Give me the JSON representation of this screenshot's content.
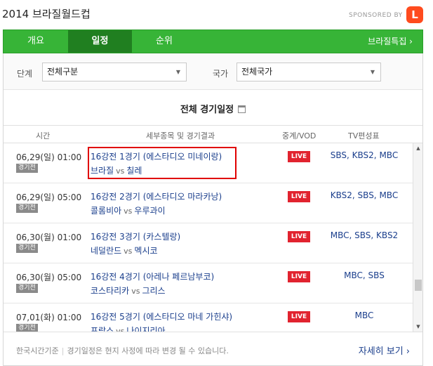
{
  "header": {
    "title": "2014 브라질월드컵",
    "sponsored_by": "SPONSORED BY"
  },
  "tabs": [
    {
      "label": "개요"
    },
    {
      "label": "일정"
    },
    {
      "label": "순위"
    }
  ],
  "special_link": "브라질특집 ›",
  "filters": {
    "stage_label": "단계",
    "stage_value": "전체구분",
    "country_label": "국가",
    "country_value": "전체국가"
  },
  "section_title": "전체 경기일정",
  "columns": {
    "time": "시간",
    "detail": "세부종목 및 경기결과",
    "relay": "중계/VOD",
    "tv": "TV편성표"
  },
  "matches": [
    {
      "time": "06,29(일) 01:00",
      "badge": "경기전",
      "title": "16강전 1경기 (에스타디오 미네이랑)",
      "home": "브라질",
      "vs": "vs",
      "away": "칠레",
      "live": "LIVE",
      "tv": "SBS, KBS2, MBC"
    },
    {
      "time": "06,29(일) 05:00",
      "badge": "경기전",
      "title": "16강전 2경기 (에스타디오 마라카낭)",
      "home": "콜롬비아",
      "vs": "vs",
      "away": "우루과이",
      "live": "LIVE",
      "tv": "KBS2, SBS, MBC"
    },
    {
      "time": "06,30(월) 01:00",
      "badge": "경기전",
      "title": "16강전 3경기 (카스텔랑)",
      "home": "네덜란드",
      "vs": "vs",
      "away": "멕시코",
      "live": "LIVE",
      "tv": "MBC, SBS, KBS2"
    },
    {
      "time": "06,30(월) 05:00",
      "badge": "경기전",
      "title": "16강전 4경기 (아레나 페르남부코)",
      "home": "코스타리카",
      "vs": "vs",
      "away": "그리스",
      "live": "LIVE",
      "tv": "MBC, SBS"
    },
    {
      "time": "07,01(화) 01:00",
      "badge": "경기전",
      "title": "16강전 5경기 (에스타디오 마네 가힌샤)",
      "home": "프랑스",
      "vs": "vs",
      "away": "나이지리아",
      "live": "LIVE",
      "tv": "MBC"
    }
  ],
  "footer": {
    "timezone": "한국시간기준",
    "notice": "경기일정은 현지 사정에 따라 변경 될 수 있습니다.",
    "more": "자세히 보기 ›"
  },
  "colors": {
    "tab_bar": "#37b437",
    "tab_active": "#207f20",
    "live": "#e1232f",
    "link": "#1a3e8c",
    "highlight": "#e00000"
  }
}
